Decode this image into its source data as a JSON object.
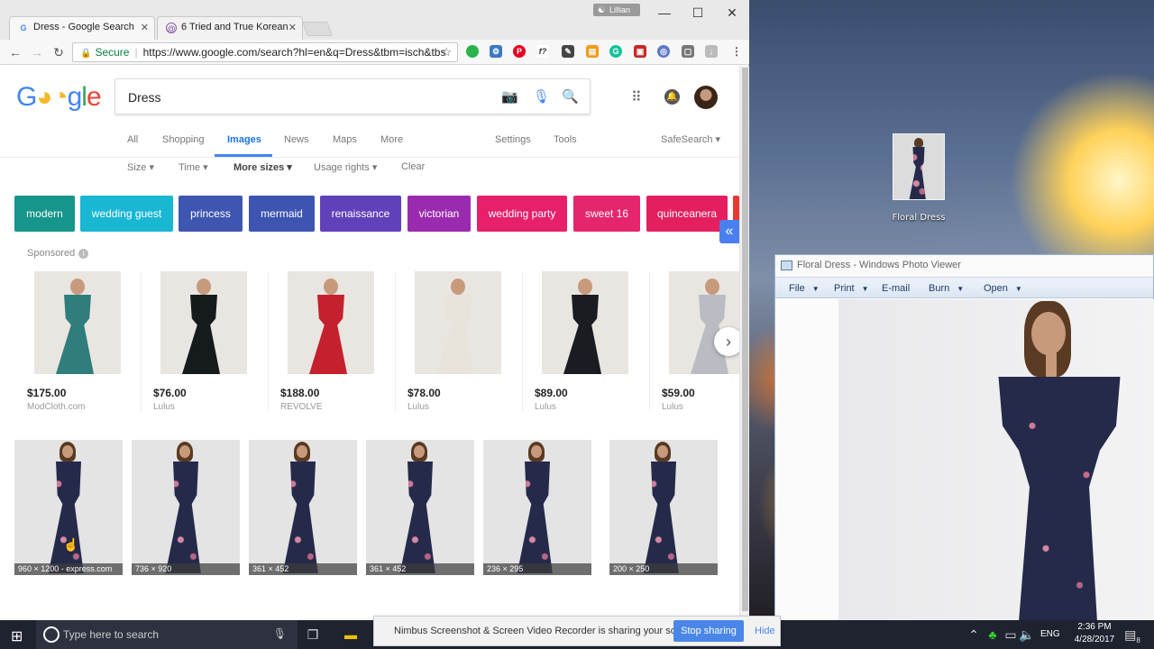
{
  "browser": {
    "tabs": [
      {
        "title": "Dress - Google Search",
        "favicon": "G"
      },
      {
        "title": "6 Tried and True Korean",
        "favicon": "@"
      }
    ],
    "profile_name": "Lillian",
    "url": "https://www.google.com/search?hl=en&q=Dress&tbm=isch&tbs",
    "secure_label": "Secure"
  },
  "google": {
    "query": "Dress",
    "nav_tabs": [
      "All",
      "Shopping",
      "Images",
      "News",
      "Maps",
      "More"
    ],
    "settings_label": "Settings",
    "tools_label": "Tools",
    "safesearch_label": "SafeSearch",
    "tools": [
      "Size",
      "Time",
      "More sizes",
      "Usage rights",
      "Clear"
    ],
    "chips": [
      {
        "label": "modern",
        "color": "#16958a"
      },
      {
        "label": "wedding guest",
        "color": "#1ab7d3"
      },
      {
        "label": "princess",
        "color": "#3f56b0"
      },
      {
        "label": "mermaid",
        "color": "#3d55b1"
      },
      {
        "label": "renaissance",
        "color": "#6141b9"
      },
      {
        "label": "victorian",
        "color": "#9b2bae"
      },
      {
        "label": "wedding party",
        "color": "#e6206a"
      },
      {
        "label": "sweet 16",
        "color": "#e6266c"
      },
      {
        "label": "quinceanera",
        "color": "#e41f5f"
      }
    ],
    "sponsored_label": "Sponsored",
    "products": [
      {
        "price": "$175.00",
        "store": "ModCloth.com",
        "dress_color": "#2f7d7c"
      },
      {
        "price": "$76.00",
        "store": "Lulus",
        "dress_color": "#151a1d"
      },
      {
        "price": "$188.00",
        "store": "REVOLVE",
        "dress_color": "#c4202e"
      },
      {
        "price": "$78.00",
        "store": "Lulus",
        "dress_color": "#e8e4dc"
      },
      {
        "price": "$89.00",
        "store": "Lulus",
        "dress_color": "#1a1c22"
      },
      {
        "price": "$59.00",
        "store": "Lulus",
        "dress_color": "#b9bcc3"
      }
    ],
    "results": [
      {
        "caption": "960 × 1200 - express.com"
      },
      {
        "caption": "736 × 920"
      },
      {
        "caption": "361 × 452"
      },
      {
        "caption": "361 × 452"
      },
      {
        "caption": "236 × 295"
      },
      {
        "caption": "200 × 250"
      }
    ]
  },
  "desktop": {
    "icon_label": "Floral Dress"
  },
  "viewer": {
    "title": "Floral Dress - Windows Photo Viewer",
    "menu": [
      "File",
      "Print",
      "E-mail",
      "Burn",
      "Open"
    ]
  },
  "sharing": {
    "message": "Nimbus Screenshot & Screen Video Recorder is sharing your screen.",
    "stop_label": "Stop sharing",
    "hide_label": "Hide"
  },
  "taskbar": {
    "search_placeholder": "Type here to search",
    "language": "ENG",
    "time": "2:36 PM",
    "date": "4/28/2017",
    "notification_count": "8"
  }
}
